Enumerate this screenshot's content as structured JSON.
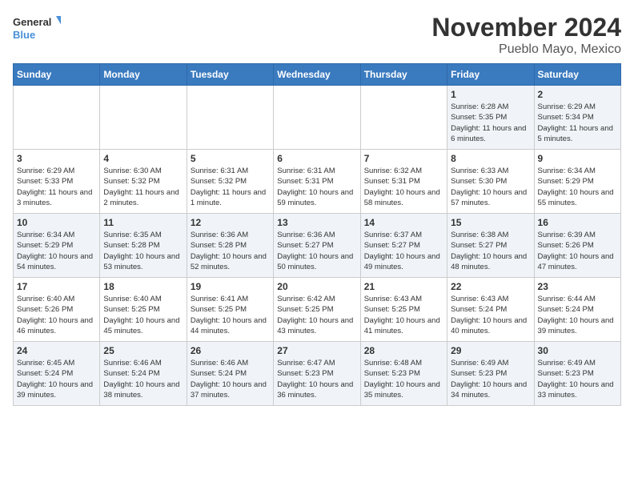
{
  "header": {
    "logo_general": "General",
    "logo_blue": "Blue",
    "title": "November 2024",
    "subtitle": "Pueblo Mayo, Mexico"
  },
  "weekdays": [
    "Sunday",
    "Monday",
    "Tuesday",
    "Wednesday",
    "Thursday",
    "Friday",
    "Saturday"
  ],
  "weeks": [
    [
      {
        "day": "",
        "info": ""
      },
      {
        "day": "",
        "info": ""
      },
      {
        "day": "",
        "info": ""
      },
      {
        "day": "",
        "info": ""
      },
      {
        "day": "",
        "info": ""
      },
      {
        "day": "1",
        "info": "Sunrise: 6:28 AM\nSunset: 5:35 PM\nDaylight: 11 hours and 6 minutes."
      },
      {
        "day": "2",
        "info": "Sunrise: 6:29 AM\nSunset: 5:34 PM\nDaylight: 11 hours and 5 minutes."
      }
    ],
    [
      {
        "day": "3",
        "info": "Sunrise: 6:29 AM\nSunset: 5:33 PM\nDaylight: 11 hours and 3 minutes."
      },
      {
        "day": "4",
        "info": "Sunrise: 6:30 AM\nSunset: 5:32 PM\nDaylight: 11 hours and 2 minutes."
      },
      {
        "day": "5",
        "info": "Sunrise: 6:31 AM\nSunset: 5:32 PM\nDaylight: 11 hours and 1 minute."
      },
      {
        "day": "6",
        "info": "Sunrise: 6:31 AM\nSunset: 5:31 PM\nDaylight: 10 hours and 59 minutes."
      },
      {
        "day": "7",
        "info": "Sunrise: 6:32 AM\nSunset: 5:31 PM\nDaylight: 10 hours and 58 minutes."
      },
      {
        "day": "8",
        "info": "Sunrise: 6:33 AM\nSunset: 5:30 PM\nDaylight: 10 hours and 57 minutes."
      },
      {
        "day": "9",
        "info": "Sunrise: 6:34 AM\nSunset: 5:29 PM\nDaylight: 10 hours and 55 minutes."
      }
    ],
    [
      {
        "day": "10",
        "info": "Sunrise: 6:34 AM\nSunset: 5:29 PM\nDaylight: 10 hours and 54 minutes."
      },
      {
        "day": "11",
        "info": "Sunrise: 6:35 AM\nSunset: 5:28 PM\nDaylight: 10 hours and 53 minutes."
      },
      {
        "day": "12",
        "info": "Sunrise: 6:36 AM\nSunset: 5:28 PM\nDaylight: 10 hours and 52 minutes."
      },
      {
        "day": "13",
        "info": "Sunrise: 6:36 AM\nSunset: 5:27 PM\nDaylight: 10 hours and 50 minutes."
      },
      {
        "day": "14",
        "info": "Sunrise: 6:37 AM\nSunset: 5:27 PM\nDaylight: 10 hours and 49 minutes."
      },
      {
        "day": "15",
        "info": "Sunrise: 6:38 AM\nSunset: 5:27 PM\nDaylight: 10 hours and 48 minutes."
      },
      {
        "day": "16",
        "info": "Sunrise: 6:39 AM\nSunset: 5:26 PM\nDaylight: 10 hours and 47 minutes."
      }
    ],
    [
      {
        "day": "17",
        "info": "Sunrise: 6:40 AM\nSunset: 5:26 PM\nDaylight: 10 hours and 46 minutes."
      },
      {
        "day": "18",
        "info": "Sunrise: 6:40 AM\nSunset: 5:25 PM\nDaylight: 10 hours and 45 minutes."
      },
      {
        "day": "19",
        "info": "Sunrise: 6:41 AM\nSunset: 5:25 PM\nDaylight: 10 hours and 44 minutes."
      },
      {
        "day": "20",
        "info": "Sunrise: 6:42 AM\nSunset: 5:25 PM\nDaylight: 10 hours and 43 minutes."
      },
      {
        "day": "21",
        "info": "Sunrise: 6:43 AM\nSunset: 5:25 PM\nDaylight: 10 hours and 41 minutes."
      },
      {
        "day": "22",
        "info": "Sunrise: 6:43 AM\nSunset: 5:24 PM\nDaylight: 10 hours and 40 minutes."
      },
      {
        "day": "23",
        "info": "Sunrise: 6:44 AM\nSunset: 5:24 PM\nDaylight: 10 hours and 39 minutes."
      }
    ],
    [
      {
        "day": "24",
        "info": "Sunrise: 6:45 AM\nSunset: 5:24 PM\nDaylight: 10 hours and 39 minutes."
      },
      {
        "day": "25",
        "info": "Sunrise: 6:46 AM\nSunset: 5:24 PM\nDaylight: 10 hours and 38 minutes."
      },
      {
        "day": "26",
        "info": "Sunrise: 6:46 AM\nSunset: 5:24 PM\nDaylight: 10 hours and 37 minutes."
      },
      {
        "day": "27",
        "info": "Sunrise: 6:47 AM\nSunset: 5:23 PM\nDaylight: 10 hours and 36 minutes."
      },
      {
        "day": "28",
        "info": "Sunrise: 6:48 AM\nSunset: 5:23 PM\nDaylight: 10 hours and 35 minutes."
      },
      {
        "day": "29",
        "info": "Sunrise: 6:49 AM\nSunset: 5:23 PM\nDaylight: 10 hours and 34 minutes."
      },
      {
        "day": "30",
        "info": "Sunrise: 6:49 AM\nSunset: 5:23 PM\nDaylight: 10 hours and 33 minutes."
      }
    ]
  ]
}
